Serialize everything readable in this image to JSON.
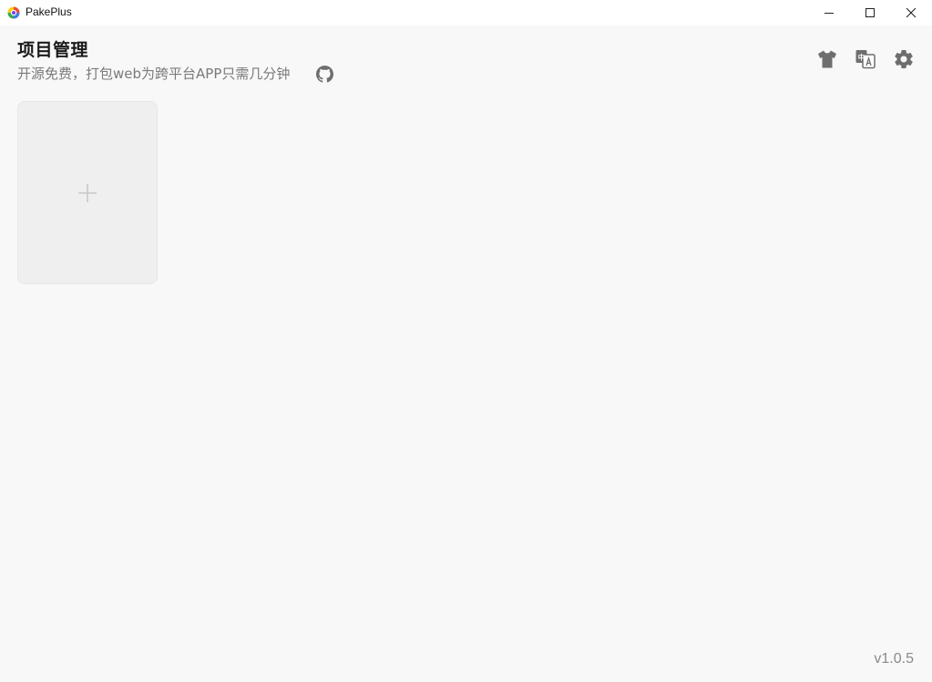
{
  "window": {
    "title": "PakePlus",
    "controls": {
      "minimize": "minimize-icon",
      "maximize": "maximize-icon",
      "close": "close-icon"
    }
  },
  "header": {
    "title": "项目管理",
    "subtitle": "开源免费，打包web为跨平台APP只需几分钟",
    "github_icon": "github-icon"
  },
  "toolbar": {
    "theme_icon": "tshirt-icon",
    "language_icon": "translate-icon",
    "language_icon_text": "中",
    "settings_icon": "gear-icon"
  },
  "projects": {
    "add_card_icon": "plus-icon"
  },
  "footer": {
    "version": "v1.0.5"
  },
  "colors": {
    "background": "#f8f8f8",
    "titlebar": "#ffffff",
    "card": "#efefef",
    "icon": "#6e6e6e",
    "subtitle": "#7a7a7a"
  }
}
